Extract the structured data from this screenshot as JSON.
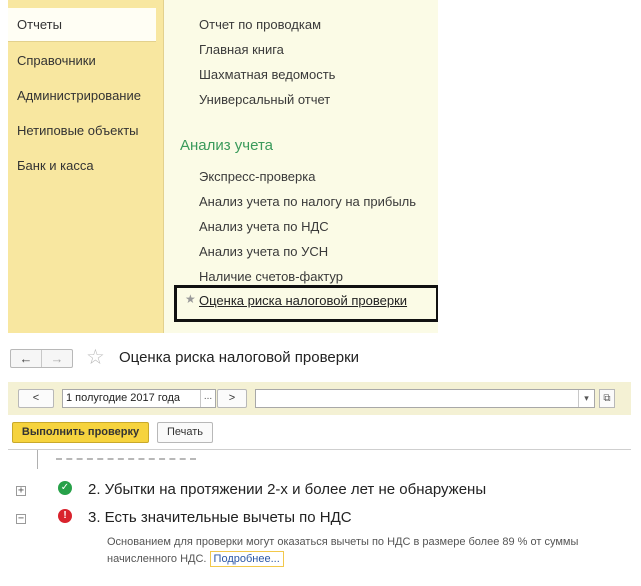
{
  "sidebar": {
    "items": [
      {
        "label": "Отчеты",
        "active": true
      },
      {
        "label": "Справочники"
      },
      {
        "label": "Администрирование"
      },
      {
        "label": "Нетиповые объекты"
      },
      {
        "label": "Банк и касса"
      }
    ]
  },
  "menu": {
    "reports": [
      "Отчет по проводкам",
      "Главная книга",
      "Шахматная ведомость",
      "Универсальный отчет"
    ],
    "analysis_section": "Анализ учета",
    "analysis": [
      "Экспресс-проверка",
      "Анализ учета по налогу на прибыль",
      "Анализ учета по НДС",
      "Анализ учета по УСН",
      "Наличие счетов-фактур"
    ],
    "highlighted": "Оценка риска налоговой проверки"
  },
  "form": {
    "title": "Оценка риска налоговой проверки",
    "nav_back": "←",
    "nav_forward": "→",
    "favorite_icon": "star-outline-icon"
  },
  "filter": {
    "prev": "<",
    "period": "1 полугодие 2017 года",
    "period_select": "...",
    "next": ">",
    "organization": "",
    "organization_dropdown": "▾",
    "organization_open": "⧉"
  },
  "toolbar": {
    "run_label": "Выполнить проверку",
    "print_label": "Печать"
  },
  "results": [
    {
      "title": "2. Убытки на протяжении 2-х и более лет не обнаружены",
      "status": "ok",
      "expander": "+"
    },
    {
      "title": "3. Есть значительные вычеты по НДС",
      "status": "warning",
      "expander": "−",
      "description": "Основанием для проверки могут оказаться вычеты по НДС в размере более 89 % от суммы начисленного НДС.",
      "more_link": "Подробнее..."
    }
  ],
  "colors": {
    "sidebar_bg": "#f8e7a0",
    "panel_bg": "#fbfbe6",
    "section_green": "#3a9a5b",
    "run_button": "#f6d33e",
    "ok_icon": "#27a149",
    "warning_icon": "#d9232d"
  }
}
